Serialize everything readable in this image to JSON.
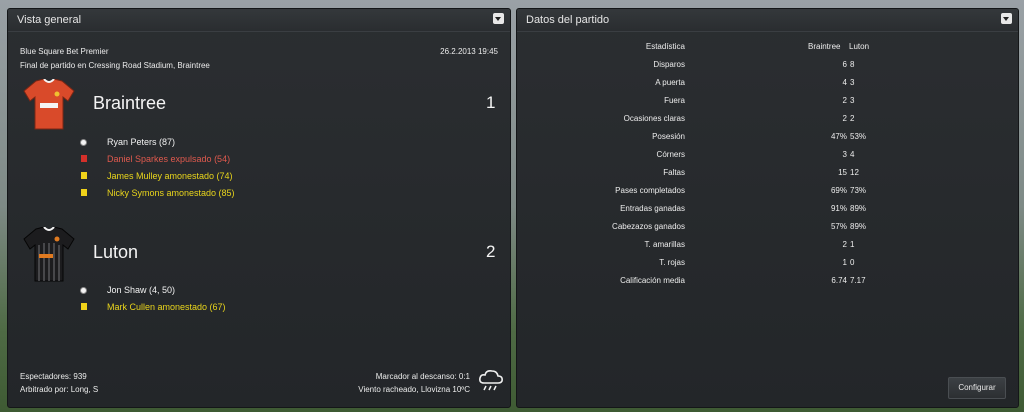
{
  "overview": {
    "title": "Vista general",
    "competition": "Blue Square Bet Premier",
    "datetime": "26.2.2013 19:45",
    "match_info": "Final de partido en Cressing Road Stadium, Braintree",
    "home": {
      "name": "Braintree",
      "score": "1",
      "events": [
        {
          "type": "goal",
          "text": "Ryan Peters (87)"
        },
        {
          "type": "red",
          "text": "Daniel Sparkes expulsado (54)"
        },
        {
          "type": "yellow",
          "text": "James Mulley amonestado (74)"
        },
        {
          "type": "yellow",
          "text": "Nicky Symons amonestado (85)"
        }
      ]
    },
    "away": {
      "name": "Luton",
      "score": "2",
      "events": [
        {
          "type": "goal",
          "text": "Jon Shaw (4, 50)"
        },
        {
          "type": "yellow",
          "text": "Mark Cullen amonestado (67)"
        }
      ]
    },
    "spectators": "Espectadores: 939",
    "referee": "Arbitrado por: Long, S",
    "halftime": "Marcador al descanso: 0:1",
    "weather": "Viento racheado, Llovizna 10ºC",
    "weather_icon": "rain-cloud-icon"
  },
  "stats": {
    "title": "Datos del partido",
    "header": {
      "label": "Estadística",
      "home": "Braintree",
      "away": "Luton"
    },
    "rows": [
      {
        "label": "Disparos",
        "home": "6",
        "away": "8"
      },
      {
        "label": "A puerta",
        "home": "4",
        "away": "3"
      },
      {
        "label": "Fuera",
        "home": "2",
        "away": "3"
      },
      {
        "label": "Ocasiones claras",
        "home": "2",
        "away": "2"
      },
      {
        "label": "Posesión",
        "home": "47%",
        "away": "53%"
      },
      {
        "label": "Córners",
        "home": "3",
        "away": "4"
      },
      {
        "label": "Faltas",
        "home": "15",
        "away": "12"
      },
      {
        "label": "Pases completados",
        "home": "69%",
        "away": "73%"
      },
      {
        "label": "Entradas ganadas",
        "home": "91%",
        "away": "89%"
      },
      {
        "label": "Cabezazos ganados",
        "home": "57%",
        "away": "89%"
      },
      {
        "label": "T. amarillas",
        "home": "2",
        "away": "1"
      },
      {
        "label": "T. rojas",
        "home": "1",
        "away": "0"
      },
      {
        "label": "Calificación media",
        "home": "6.74",
        "away": "7.17"
      }
    ],
    "configure_label": "Configurar"
  }
}
